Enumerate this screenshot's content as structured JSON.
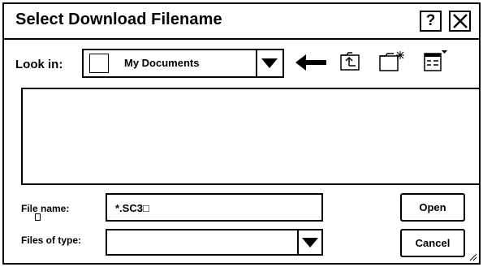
{
  "dialog": {
    "title": "Select Download Filename",
    "help_label": "?",
    "close_label": "✕"
  },
  "lookin": {
    "label": "Look in:",
    "value": "My Documents"
  },
  "toolbar": {
    "icons": [
      "back-arrow-icon",
      "up-one-level-icon",
      "create-new-folder-icon",
      "view-menu-icon"
    ]
  },
  "filename": {
    "label": "File name:",
    "value": "*.SC3□"
  },
  "filetype": {
    "label": "Files of type:",
    "value": ""
  },
  "buttons": {
    "open": "Open",
    "cancel": "Cancel"
  }
}
